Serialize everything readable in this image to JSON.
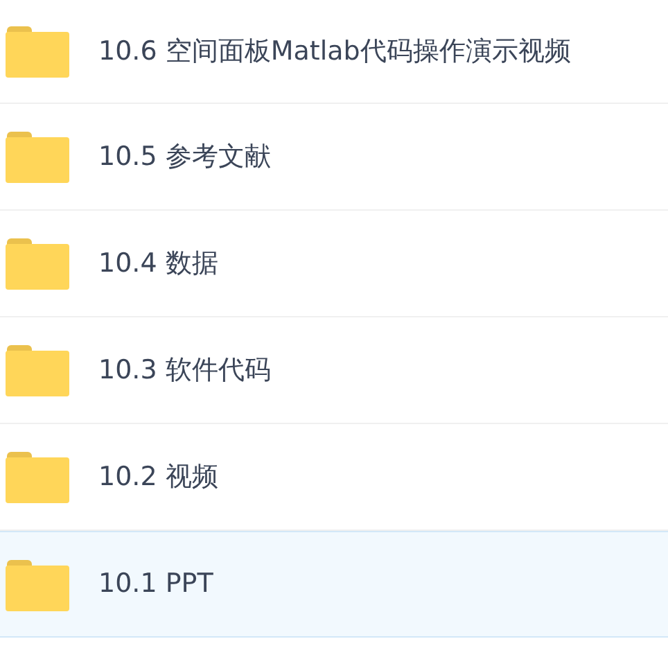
{
  "folders": [
    {
      "name": "10.6 空间面板Matlab代码操作演示视频",
      "selected": false
    },
    {
      "name": "10.5 参考文献",
      "selected": false
    },
    {
      "name": "10.4 数据",
      "selected": false
    },
    {
      "name": "10.3 软件代码",
      "selected": false
    },
    {
      "name": "10.2 视频",
      "selected": false
    },
    {
      "name": "10.1 PPT",
      "selected": true
    }
  ]
}
